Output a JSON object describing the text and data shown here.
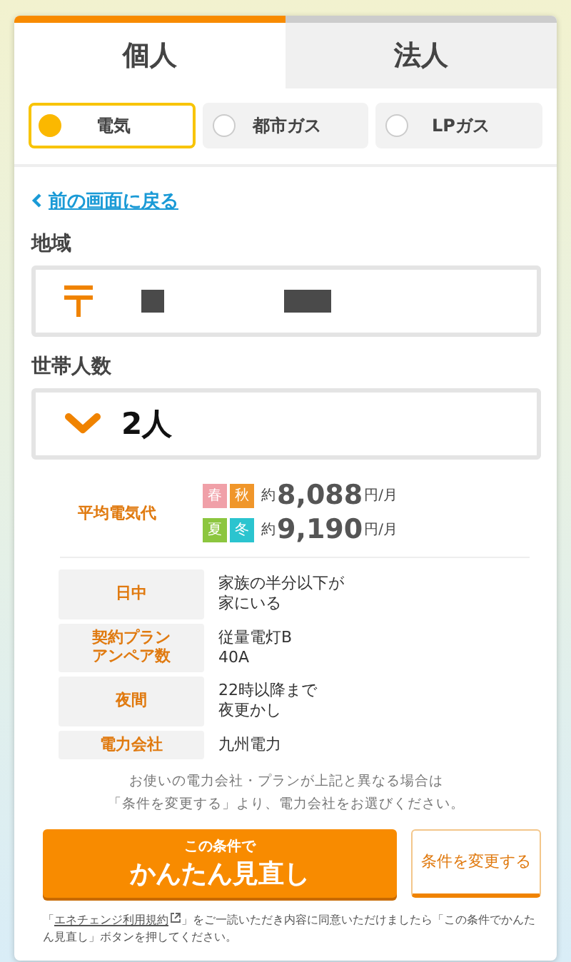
{
  "tabs": [
    {
      "label": "個人",
      "selected": true
    },
    {
      "label": "法人",
      "selected": false
    }
  ],
  "energy_options": [
    {
      "label": "電気",
      "selected": true
    },
    {
      "label": "都市ガス",
      "selected": false
    },
    {
      "label": "LPガス",
      "selected": false
    }
  ],
  "back_link": "前の画面に戻る",
  "region": {
    "label": "地域"
  },
  "household": {
    "label": "世帯人数",
    "value": "2人"
  },
  "average": {
    "label": "平均電気代",
    "rows": [
      {
        "badges": [
          {
            "label": "春",
            "color": "#f0a0a8"
          },
          {
            "label": "秋",
            "color": "#f0962a"
          }
        ],
        "approx": "約",
        "amount": "8,088",
        "unit": "円/月"
      },
      {
        "badges": [
          {
            "label": "夏",
            "color": "#8cc63f"
          },
          {
            "label": "冬",
            "color": "#2bc4cf"
          }
        ],
        "approx": "約",
        "amount": "9,190",
        "unit": "円/月"
      }
    ]
  },
  "details": [
    {
      "label": [
        "日中"
      ],
      "value": [
        "家族の半分以下が",
        "家にいる"
      ]
    },
    {
      "label": [
        "契約プラン",
        "アンペア数"
      ],
      "value": [
        "従量電灯B",
        "40A"
      ]
    },
    {
      "label": [
        "夜間"
      ],
      "value": [
        "22時以降まで",
        "夜更かし"
      ]
    },
    {
      "label": [
        "電力会社"
      ],
      "value": [
        "九州電力"
      ]
    }
  ],
  "notice": [
    "お使いの電力会社・プランが上記と異なる場合は",
    "「条件を変更する」より、電力会社をお選びください。"
  ],
  "primary_button": {
    "small": "この条件で",
    "large": "かんたん見直し"
  },
  "secondary_button": "条件を変更する",
  "footer": {
    "before": "「",
    "link": "エネチェンジ利用規約",
    "after": "」をご一読いただき内容に同意いただけましたら「この条件でかんたん見直し」ボタンを押してください。"
  }
}
